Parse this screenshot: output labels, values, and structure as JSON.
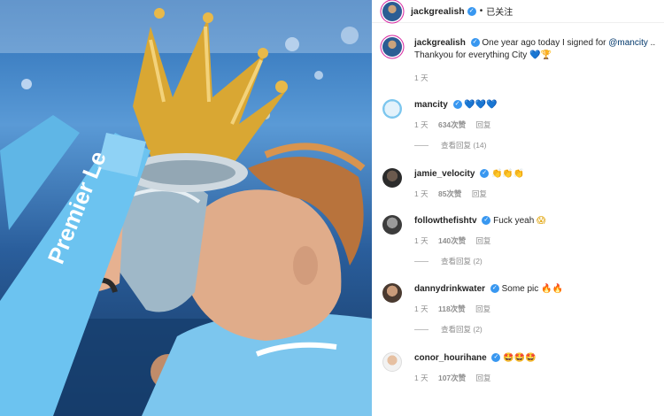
{
  "post": {
    "author": "jackgrealish",
    "follow_status": "已关注",
    "dot": "•",
    "caption": {
      "author": "jackgrealish",
      "text": "One year ago today I signed for",
      "mention": "@mancity",
      "ellipsis": "..",
      "second_line": "Thankyou for everything City",
      "emoji": "💙🏆",
      "time": "1 天"
    },
    "image": {
      "description_icon": "premier-league-trophy-photo",
      "ribbon_text": "Premier Le"
    }
  },
  "comments": [
    {
      "user": "mancity",
      "text": "",
      "emoji": "💙💙💙",
      "time": "1 天",
      "likes": "634次赞",
      "reply_label": "回复",
      "view_replies": "查看回复 (14)",
      "avatar": "man-city-crest-icon"
    },
    {
      "user": "jamie_velocity",
      "text": "",
      "emoji": "👏👏👏",
      "time": "1 天",
      "likes": "85次赞",
      "reply_label": "回复",
      "view_replies": "",
      "avatar": "user-avatar-icon"
    },
    {
      "user": "followthefishtv",
      "text": "Fuck yeah",
      "emoji": "😱",
      "time": "1 天",
      "likes": "140次赞",
      "reply_label": "回复",
      "view_replies": "查看回复 (2)",
      "avatar": "user-avatar-icon"
    },
    {
      "user": "dannydrinkwater",
      "text": "Some pic",
      "emoji": "🔥🔥",
      "time": "1 天",
      "likes": "118次赞",
      "reply_label": "回复",
      "view_replies": "查看回复 (2)",
      "avatar": "user-avatar-icon"
    },
    {
      "user": "conor_hourihane",
      "text": "",
      "emoji": "🤩🤩🤩",
      "time": "1 天",
      "likes": "107次赞",
      "reply_label": "回复",
      "view_replies": "",
      "avatar": "user-avatar-icon"
    }
  ],
  "colors": {
    "verified": "#3897f0",
    "mention": "#00376b",
    "meta": "#8e8e8e",
    "photo_sky": "#2a6db5",
    "trophy_gold": "#d9a733",
    "ribbon_blue": "#6cc3f0"
  }
}
